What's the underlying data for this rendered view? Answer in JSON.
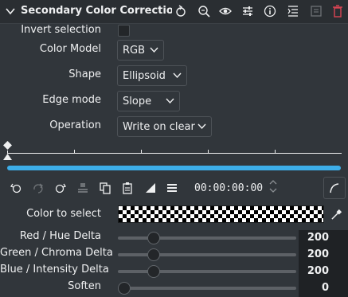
{
  "header": {
    "title": "Secondary Color Correction A...",
    "icons": [
      "collapse-chevron-icon",
      "reset-icon",
      "zoom-icon",
      "visibility-eye-icon",
      "settings-sliders-icon",
      "info-icon",
      "menu-list-icon",
      "save-disabled-icon",
      "delete-icon"
    ]
  },
  "form": {
    "invert_label": "Invert selection",
    "invert_checked": false,
    "color_model_label": "Color Model",
    "color_model_value": "RGB",
    "shape_label": "Shape",
    "shape_value": "Ellipsoid",
    "edge_label": "Edge mode",
    "edge_value": "Slope",
    "operation_label": "Operation",
    "operation_value": "Write on clear"
  },
  "toolbar": {
    "timecode": "00:00:00:00",
    "icons": [
      "previous-keyframe-icon",
      "add-keyframe-icon",
      "next-keyframe-icon",
      "stack-icon",
      "copy-icon",
      "paste-icon",
      "interpolation-icon",
      "menu-icon",
      "spin-icon",
      "curve-icon"
    ]
  },
  "color_select": {
    "label": "Color to select"
  },
  "sliders": [
    {
      "label": "Red / Hue Delta",
      "value": "200",
      "fraction": 0.2
    },
    {
      "label": "Green / Chroma Delta",
      "value": "200",
      "fraction": 0.2
    },
    {
      "label": "Blue / Intensity Delta",
      "value": "200",
      "fraction": 0.2
    },
    {
      "label": "Soften",
      "value": "0",
      "fraction": 0.0
    }
  ],
  "colors": {
    "accent": "#3daee9",
    "danger": "#da4453",
    "bg": "#31363b"
  }
}
